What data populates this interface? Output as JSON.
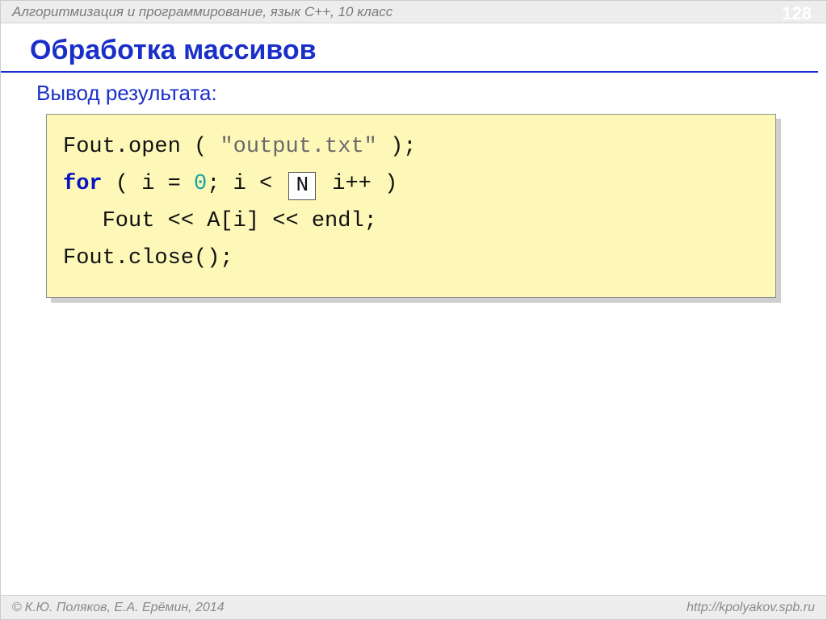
{
  "header": {
    "course": "Алгоритмизация и программирование, язык C++, 10 класс",
    "page": "128"
  },
  "title": "Обработка массивов",
  "subtitle": "Вывод результата",
  "code": {
    "l1_a": "Fout.open ( ",
    "l1_str": "\"output.txt\"",
    "l1_b": " );",
    "l2_for": "for",
    "l2_a": " ( i = ",
    "l2_zero": "0",
    "l2_b": "; i < ",
    "l2_badge": "N",
    "l2_c": "  i++ )",
    "l3": "   Fout << A[i] << endl;",
    "l4": "Fout.close();"
  },
  "footer": {
    "left": "К.Ю. Поляков, Е.А. Ерёмин, 2014",
    "right": "http://kpolyakov.spb.ru"
  }
}
